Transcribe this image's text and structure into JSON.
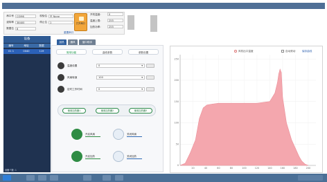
{
  "serial": {
    "fields": [
      {
        "label": "串口号",
        "value": "COM6"
      },
      {
        "label": "波特率",
        "value": "38400"
      },
      {
        "label": "数据位",
        "value": "8"
      }
    ],
    "fields2": [
      {
        "label": "校验位",
        "value": "无 None"
      },
      {
        "label": "停止位",
        "value": "1"
      }
    ],
    "open_button": "打开串口",
    "reset_link": "重置串口",
    "send_fields": [
      {
        "label": "开机温度:",
        "value": "0"
      },
      {
        "label": "温度上限:",
        "value": "255"
      },
      {
        "label": "加热功率:",
        "value": "255"
      }
    ]
  },
  "left_panel": {
    "title": "设备",
    "headers": [
      "编号",
      "地址",
      "数据"
    ],
    "rows": [
      [
        "01 1",
        "0040",
        "119"
      ]
    ],
    "footer": "设备个数: 1"
  },
  "tabs": [
    "加热",
    "通风",
    "窗口助手"
  ],
  "subtabs": [
    "常用功能",
    "曲线参数",
    "参数设置"
  ],
  "controls": [
    {
      "name": "温度设置",
      "value": "0",
      "icon": "thermometer-icon"
    },
    {
      "name": "风扇转速",
      "value": "100",
      "icon": "fan-icon"
    },
    {
      "name": "定时工作时间",
      "value": "0",
      "icon": "clock-icon"
    }
  ],
  "group_buttons": [
    "使用加热器1",
    "使用加热器2",
    "使用加热器3"
  ],
  "actions": [
    {
      "label": "开启风扇",
      "icon": "fan-on-icon",
      "color": "#2f8c44"
    },
    {
      "label": "关闭风扇",
      "icon": "fan-off-icon",
      "color": "#2f8c44"
    },
    {
      "label": "开启加热",
      "icon": "check-icon",
      "color": "#2f8c44"
    },
    {
      "label": "关闭加热",
      "icon": "cross-icon",
      "color": "#2f8c44"
    }
  ],
  "chart_data": {
    "type": "area",
    "title": "",
    "legend": [
      {
        "name": "风机出口温度",
        "color": "#f4a0a8"
      }
    ],
    "options": [
      "自动滚动",
      "保存曲线"
    ],
    "xlabel": "",
    "ylabel": "",
    "x_ticks": [
      20,
      40,
      60,
      80,
      100,
      120,
      140,
      160,
      180,
      200
    ],
    "y_ticks": [
      0,
      50,
      100,
      150,
      200,
      250
    ],
    "xlim": [
      0,
      212
    ],
    "ylim": [
      0,
      260
    ],
    "x": [
      0,
      8,
      16,
      24,
      30,
      36,
      42,
      50,
      60,
      80,
      100,
      120,
      140,
      148,
      152,
      154,
      156,
      158,
      160,
      166,
      170,
      174,
      180,
      186,
      190,
      195,
      200
    ],
    "y": [
      0,
      5,
      30,
      60,
      110,
      135,
      142,
      144,
      146,
      146,
      146,
      146,
      150,
      170,
      195,
      215,
      226,
      218,
      160,
      100,
      80,
      60,
      40,
      20,
      10,
      3,
      0
    ],
    "grid": true,
    "colors": {
      "fill": "#f4a7ae",
      "stroke": "#ea8f99"
    }
  },
  "colors": {
    "accent": "#2f5f9e",
    "header": "#4f6f96"
  }
}
